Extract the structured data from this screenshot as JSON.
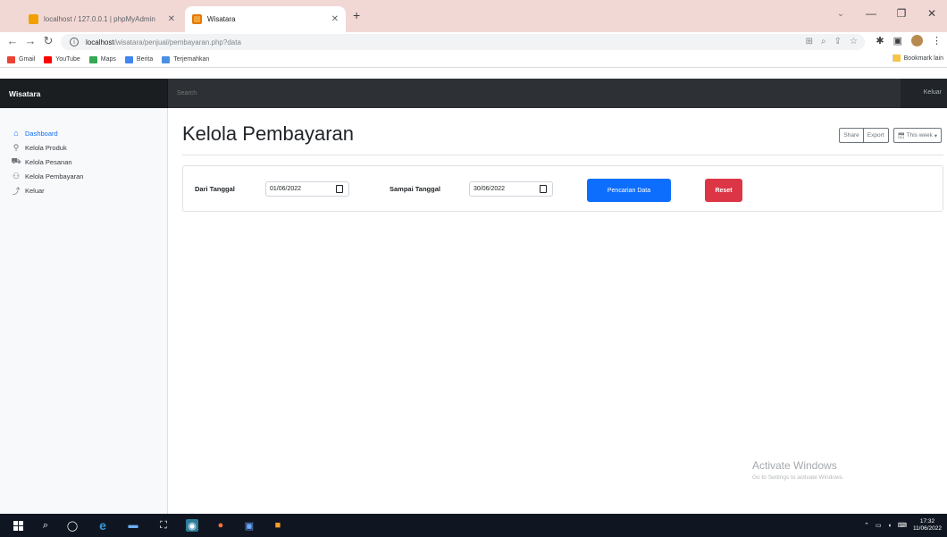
{
  "browser": {
    "tabs": [
      {
        "title": "localhost / 127.0.0.1 | phpMyAdmin",
        "active": false
      },
      {
        "title": "Wisatara",
        "active": true
      }
    ],
    "url_host": "localhost",
    "url_path": "/wisatara/penjual/pembayaran.php?data",
    "bookmarks": [
      "Gmail",
      "YouTube",
      "Maps",
      "Berita",
      "Terjemahkan"
    ],
    "bookmarks_other": "Bookmark lain"
  },
  "app": {
    "brand": "Wisatara",
    "search_placeholder": "Search",
    "signout": "Keluar"
  },
  "sidebar": {
    "items": [
      {
        "label": "Dashboard",
        "icon": "home-icon",
        "active": true
      },
      {
        "label": "Kelola Produk",
        "icon": "user-icon",
        "active": false
      },
      {
        "label": "Kelola Pesanan",
        "icon": "cart-icon",
        "active": false
      },
      {
        "label": "Kelola Pembayaran",
        "icon": "users-icon",
        "active": false
      },
      {
        "label": "Keluar",
        "icon": "logout-icon",
        "active": false
      }
    ]
  },
  "main": {
    "title": "Kelola Pembayaran",
    "toolbar": {
      "share": "Share",
      "export": "Export",
      "this_week": "This week"
    }
  },
  "filter": {
    "from_label": "Dari Tanggal",
    "from_value": "01/06/2022",
    "to_label": "Sampai Tanggal",
    "to_value": "30/06/2022",
    "search_button": "Pencarian Data",
    "reset_button": "Reset"
  },
  "watermark": {
    "line1": "Activate Windows",
    "line2": "Go to Settings to activate Windows."
  },
  "taskbar": {
    "time": "17:32",
    "date": "11/06/2022"
  },
  "colors": {
    "primary": "#0d6efd",
    "danger": "#dc3545",
    "navbar": "#212529",
    "tabstrip": "#f2d8d5"
  }
}
